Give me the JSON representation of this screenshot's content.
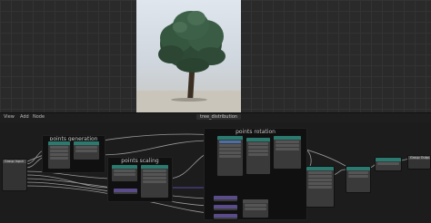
{
  "header": {
    "menus": [
      "View",
      "Add",
      "Node"
    ],
    "file_name": "tree_distribution"
  },
  "frames": {
    "points_generation": "points generation",
    "points_scaling": "points scaling",
    "points_rotation": "points rotation"
  },
  "nodes": {
    "group_input": "Group Input",
    "group_output": "Group Output",
    "realize": "Realize Instances",
    "instance_on_points": "Instance on Points"
  },
  "colors": {
    "node_teal": "#2a7a6f",
    "node_blue": "#3b5f8c",
    "node_purple": "#5a4c8a",
    "wire": "#9a9a9a",
    "wire_vector": "#6a5acd",
    "wire_float": "#a0a0a0"
  }
}
